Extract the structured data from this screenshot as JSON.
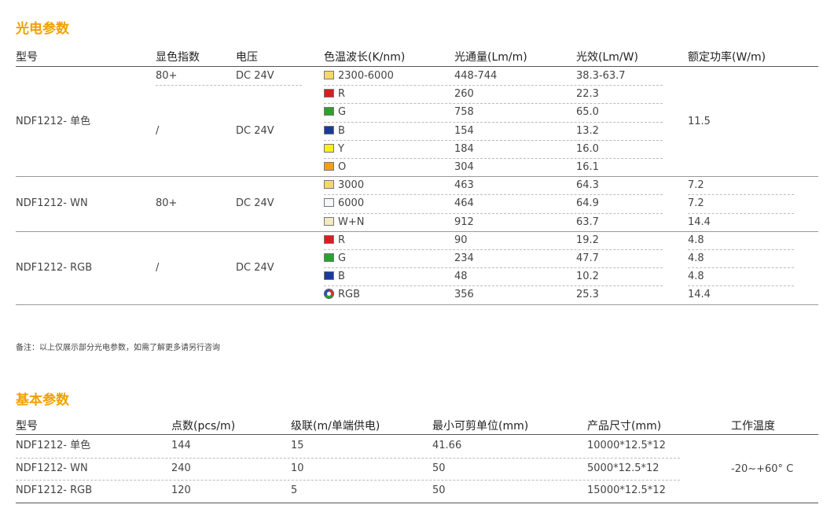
{
  "photo": {
    "title": "光电参数",
    "headers": [
      "型号",
      "显色指数",
      "电压",
      "色温波长(K/nm)",
      "光通量(Lm/m)",
      "光效(Lm/W)",
      "额定功率(W/m)"
    ],
    "groups": [
      {
        "model": "NDF1212- 单色",
        "cri_main": "/",
        "voltage_main": "DC 24V",
        "power": "11.5",
        "rows": [
          {
            "cri": "80+",
            "voltage": "DC 24V",
            "swatch": "#f5d76e",
            "color": "2300-6000",
            "flux": "448-744",
            "efficacy": "38.3-63.7"
          },
          {
            "swatch": "#d42020",
            "color": "R",
            "flux": "260",
            "efficacy": "22.3"
          },
          {
            "swatch": "#2ea02e",
            "color": "G",
            "flux": "758",
            "efficacy": "65.0"
          },
          {
            "swatch": "#1a3a9a",
            "color": "B",
            "flux": "154",
            "efficacy": "13.2"
          },
          {
            "swatch": "#f8ee20",
            "color": "Y",
            "flux": "184",
            "efficacy": "16.0"
          },
          {
            "swatch": "#f0a010",
            "color": "O",
            "flux": "304",
            "efficacy": "16.1"
          }
        ]
      },
      {
        "model": "NDF1212- WN",
        "cri_main": "80+",
        "voltage_main": "DC 24V",
        "rows": [
          {
            "swatch": "#f5d76e",
            "color": "3000",
            "flux": "463",
            "efficacy": "64.3",
            "power": "7.2"
          },
          {
            "swatch": "#f4f7fb",
            "color": "6000",
            "flux": "464",
            "efficacy": "64.9",
            "power": "7.2"
          },
          {
            "swatch": "#f2ebc0",
            "color": "W+N",
            "flux": "912",
            "efficacy": "63.7",
            "power": "14.4"
          }
        ]
      },
      {
        "model": "NDF1212- RGB",
        "cri_main": "/",
        "voltage_main": "DC 24V",
        "rows": [
          {
            "swatch": "#d42020",
            "color": "R",
            "flux": "90",
            "efficacy": "19.2",
            "power": "4.8"
          },
          {
            "swatch": "#2ea02e",
            "color": "G",
            "flux": "234",
            "efficacy": "47.7",
            "power": "4.8"
          },
          {
            "swatch": "#1a3a9a",
            "color": "B",
            "flux": "48",
            "efficacy": "10.2",
            "power": "4.8"
          },
          {
            "swatch": "rgb",
            "color": "RGB",
            "flux": "356",
            "efficacy": "25.3",
            "power": "14.4"
          }
        ]
      }
    ],
    "note": "备注：以上仅展示部分光电参数，如需了解更多请另行咨询"
  },
  "basic": {
    "title": "基本参数",
    "headers": [
      "型号",
      "点数(pcs/m)",
      "级联(m/单端供电)",
      "最小可剪单位(mm)",
      "产品尺寸(mm)",
      "工作温度"
    ],
    "rows": [
      [
        "NDF1212- 单色",
        "144",
        "15",
        "41.66",
        "10000*12.5*12"
      ],
      [
        "NDF1212- WN",
        "240",
        "10",
        "50",
        "5000*12.5*12"
      ],
      [
        "NDF1212- RGB",
        "120",
        "5",
        "50",
        "15000*12.5*12"
      ]
    ],
    "temp": "-20~+60° C"
  },
  "colors": {
    "accent": "#f0a000"
  }
}
